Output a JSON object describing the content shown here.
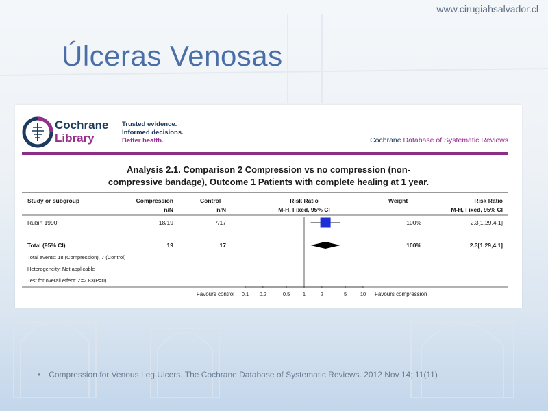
{
  "slide": {
    "site_url": "www.cirugiahsalvador.cl",
    "title": "Úlceras Venosas",
    "bullet_text": "Compression for Venous Leg Ulcers. The Cochrane Database of Systematic Reviews. 2012 Nov 14; 11(11)"
  },
  "cochrane": {
    "logo_line1": "Cochrane",
    "logo_line2": "Library",
    "tagline": [
      "Trusted evidence.",
      "Informed decisions.",
      "Better health."
    ],
    "db_name_part1": "Cochrane ",
    "db_name_part2": "Database of Systematic Reviews",
    "brand_color": "#1b3a5e",
    "accent_color": "#962e8c"
  },
  "analysis": {
    "title_line1": "Analysis 2.1.   Comparison 2 Compression vs no compression (non-",
    "title_line2": "compressive bandage), Outcome 1 Patients with complete healing at 1 year.",
    "headers": {
      "study": "Study or subgroup",
      "compression": "Compression",
      "compression_sub": "n/N",
      "control": "Control",
      "control_sub": "n/N",
      "rr": "Risk Ratio",
      "rr_sub": "M-H, Fixed, 95% CI",
      "weight": "Weight",
      "rr2": "Risk Ratio",
      "rr2_sub": "M-H, Fixed, 95% CI"
    },
    "study_row": {
      "name": "Rubin 1990",
      "compression": "18/19",
      "control": "7/17",
      "weight": "100%",
      "rr_text": "2.3[1.29,4.1]"
    },
    "total_row": {
      "name": "Total (95% CI)",
      "compression": "19",
      "control": "17",
      "weight": "100%",
      "rr_text": "2.3[1.29,4.1]"
    },
    "notes": [
      "Total events: 18 (Compression), 7 (Control)",
      "Heterogeneity: Not applicable",
      "Test for overall effect: Z=2.83(P=0)"
    ],
    "axis": {
      "left_label": "Favours control",
      "right_label": "Favours compression",
      "ticks": [
        "0.1",
        "0.2",
        "0.5",
        "1",
        "2",
        "5",
        "10"
      ]
    }
  },
  "chart_data": {
    "type": "forest",
    "scale": "log",
    "xlim": [
      0.1,
      10
    ],
    "reference_line": 1,
    "studies": [
      {
        "name": "Rubin 1990",
        "rr": 2.3,
        "ci": [
          1.29,
          4.1
        ],
        "weight": 100
      }
    ],
    "pooled": {
      "name": "Total (95% CI)",
      "rr": 2.3,
      "ci": [
        1.29,
        4.1
      ]
    },
    "marker_color": "#1f2fd6"
  }
}
